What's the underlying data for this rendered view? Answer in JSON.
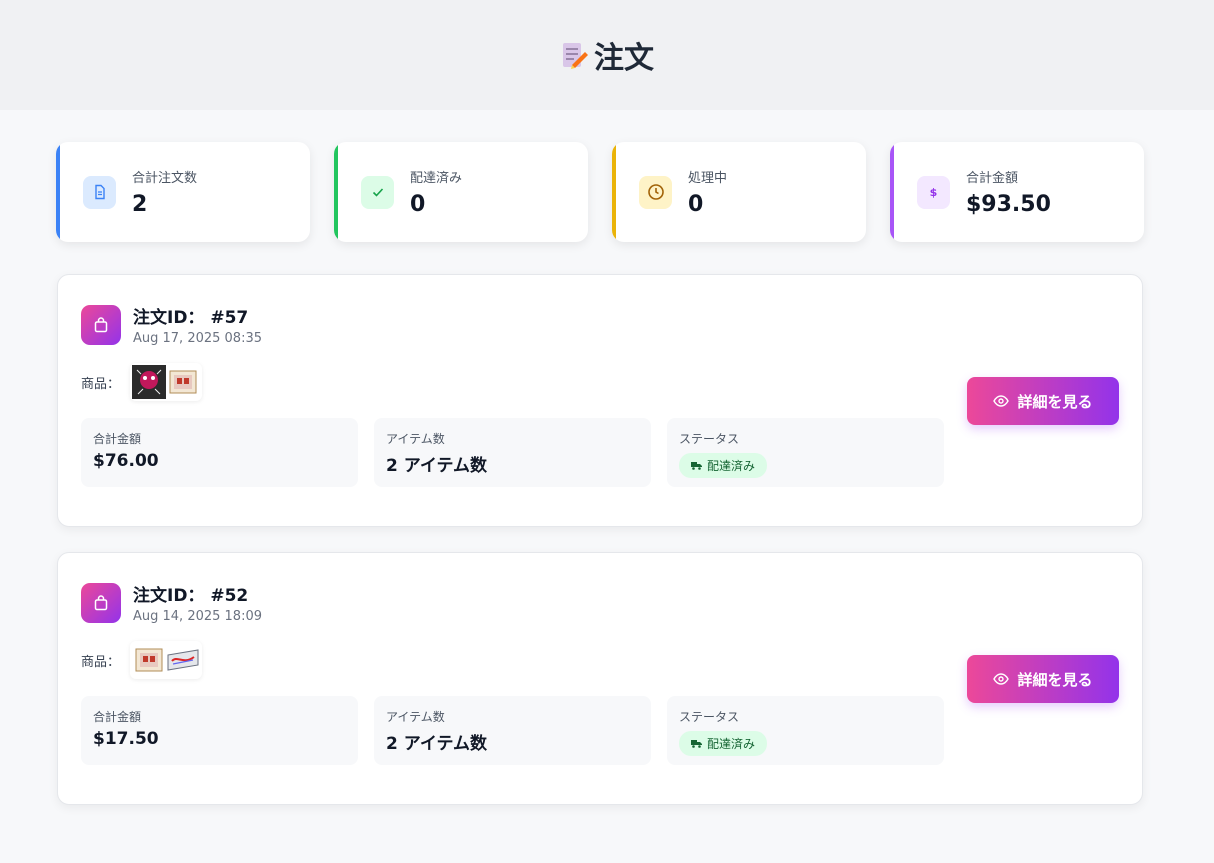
{
  "header": {
    "title": "注文",
    "icon": "memo-icon"
  },
  "stats": [
    {
      "label": "合計注文数",
      "value": "2",
      "icon": "document-icon",
      "color": "#3b82f6"
    },
    {
      "label": "配達済み",
      "value": "0",
      "icon": "check-icon",
      "color": "#22c55e"
    },
    {
      "label": "処理中",
      "value": "0",
      "icon": "clock-icon",
      "color": "#eab308"
    },
    {
      "label": "合計金額",
      "value": "$93.50",
      "icon": "dollar-icon",
      "color": "#a855f7"
    }
  ],
  "orders": [
    {
      "id_label": "注文ID：",
      "id": "#57",
      "date": "Aug 17, 2025 08:35",
      "products_label": "商品：",
      "total_label": "合計金額",
      "total": "$76.00",
      "items_label": "アイテム数",
      "items": "2 アイテム数",
      "status_label": "ステータス",
      "status": "配達済み",
      "button": "詳細を見る"
    },
    {
      "id_label": "注文ID：",
      "id": "#52",
      "date": "Aug 14, 2025 18:09",
      "products_label": "商品：",
      "total_label": "合計金額",
      "total": "$17.50",
      "items_label": "アイテム数",
      "items": "2 アイテム数",
      "status_label": "ステータス",
      "status": "配達済み",
      "button": "詳細を見る"
    }
  ]
}
